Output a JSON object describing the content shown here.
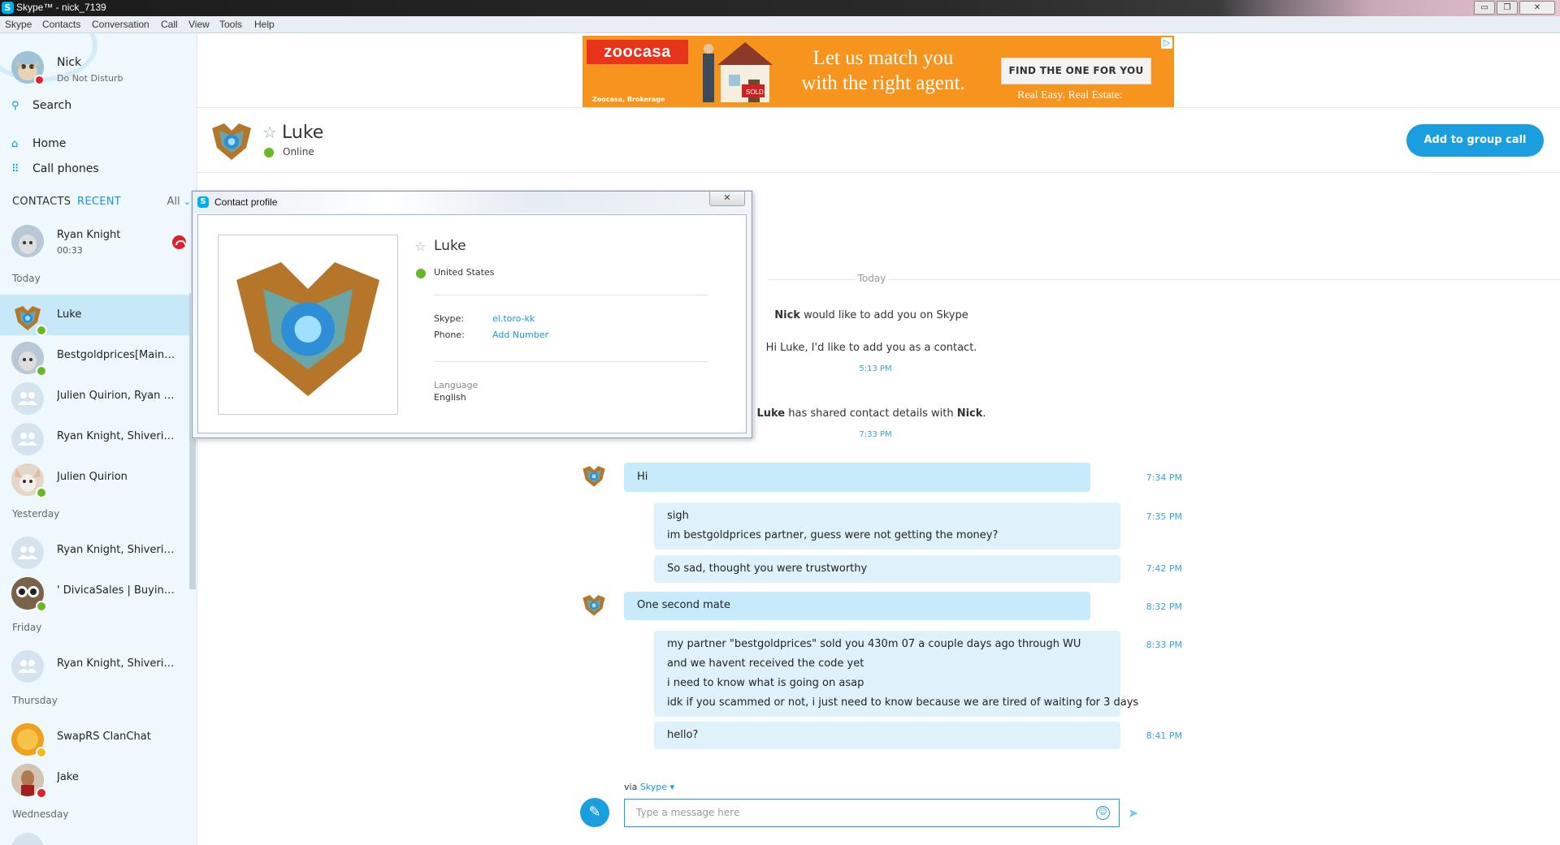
{
  "window": {
    "title": "Skype™ - nick_7139"
  },
  "menu": [
    "Skype",
    "Contacts",
    "Conversation",
    "Call",
    "View",
    "Tools",
    "Help"
  ],
  "me": {
    "name": "Nick",
    "status": "Do Not Disturb"
  },
  "nav": {
    "search": "Search",
    "home": "Home",
    "call_phones": "Call phones"
  },
  "tabs": {
    "contacts": "CONTACTS",
    "recent": "RECENT",
    "filter": "All"
  },
  "active_call": {
    "name": "Ryan Knight",
    "duration": "00:33"
  },
  "sections": {
    "today": "Today",
    "yesterday": "Yesterday",
    "friday": "Friday",
    "thursday": "Thursday",
    "wednesday": "Wednesday"
  },
  "contacts": [
    {
      "name": "Luke",
      "status": "online"
    },
    {
      "name": "Bestgoldprices[MainRe...",
      "status": "online"
    },
    {
      "name": "Julien Quirion, Ryan Kni...",
      "status": "group"
    },
    {
      "name": "Ryan Knight, Shiverinkni...",
      "status": "group"
    },
    {
      "name": "Julien Quirion",
      "status": "online"
    },
    {
      "name": "Ryan Knight, Shiverinkni...",
      "status": "group"
    },
    {
      "name": "' DivicaSales | Buying an...",
      "status": "online"
    },
    {
      "name": "Ryan Knight, Shiverinkni...",
      "status": "group"
    },
    {
      "name": "SwapRS ClanChat",
      "status": "away"
    },
    {
      "name": "Jake",
      "status": "dnd"
    }
  ],
  "ad": {
    "brand": "zoocasa",
    "broker": "Zoocasa, Brokerage",
    "headline_1": "Let us match you",
    "headline_2": "with the right agent.",
    "cta": "FIND THE ONE FOR YOU",
    "tagline": "Real Easy. Real Estate:",
    "sold_sign": "SOLD"
  },
  "conversation": {
    "name": "Luke",
    "status": "Online",
    "group_call_button": "Add to group call",
    "day_label": "Today",
    "system_messages": [
      {
        "bold": "Nick",
        "text": " would like to add you on Skype"
      },
      {
        "text": "Hi Luke, I'd like to add you as a contact.",
        "time": "5:13 PM"
      },
      {
        "bold1": "Luke",
        "text": " has shared contact details with ",
        "bold2": "Nick",
        "end": ".",
        "time": "7:33 PM"
      }
    ],
    "messages": [
      {
        "from": "Luke",
        "lines": [
          "Hi"
        ],
        "time": "7:34 PM"
      },
      {
        "from": "Nick",
        "lines": [
          "sigh",
          "im bestgoldprices partner, guess were not getting the money?"
        ],
        "time": "7:35 PM"
      },
      {
        "from": "Nick",
        "lines": [
          "So sad, thought you were trustworthy"
        ],
        "time": "7:42 PM"
      },
      {
        "from": "Luke",
        "lines": [
          "One second mate"
        ],
        "time": "8:32 PM"
      },
      {
        "from": "Nick",
        "lines": [
          "my partner \"bestgoldprices\" sold you 430m 07 a couple days ago through WU",
          "and we havent received the code yet",
          "i need to know what is going on asap",
          "idk if you scammed or not, i just need to know because we are tired of waiting for 3 days"
        ],
        "time": "8:33 PM"
      },
      {
        "from": "Nick",
        "lines": [
          "hello?"
        ],
        "time": "8:41 PM"
      }
    ],
    "via_label": "via",
    "via_link": "Skype",
    "input_placeholder": "Type a message here"
  },
  "profile_dialog": {
    "title": "Contact profile",
    "name": "Luke",
    "country": "United States",
    "skype_label": "Skype:",
    "skype_value": "el.toro-kk",
    "phone_label": "Phone:",
    "phone_value": "Add Number",
    "language_label": "Language",
    "language_value": "English"
  },
  "colors": {
    "accent": "#1a9ee0",
    "bubble": "#c8ebfb",
    "sidebar": "#eef8fd",
    "online": "#68b828",
    "dnd": "#e0202e",
    "ad_orange": "#f7941d"
  }
}
